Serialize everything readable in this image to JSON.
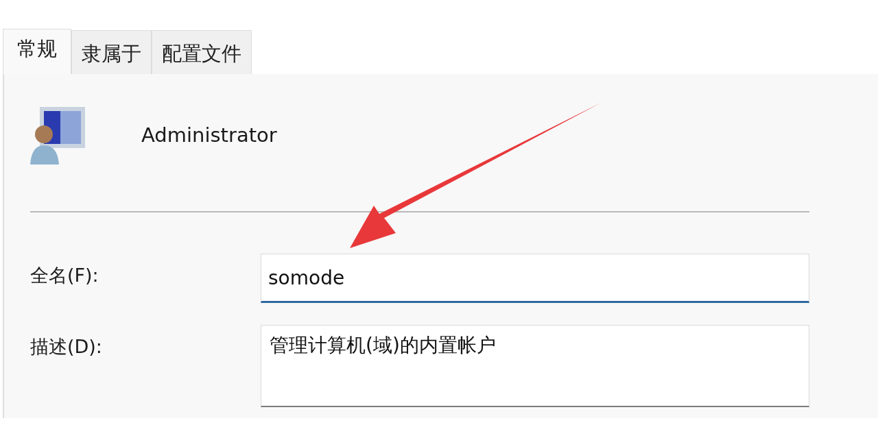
{
  "tabs": [
    {
      "label": "常规",
      "selected": true
    },
    {
      "label": "隶属于",
      "selected": false
    },
    {
      "label": "配置文件",
      "selected": false
    }
  ],
  "user": {
    "name": "Administrator"
  },
  "fields": [
    {
      "kind": "line",
      "label": "全名(F):",
      "value": "somode",
      "focused": true
    },
    {
      "kind": "multiline",
      "label": "描述(D):",
      "value": "管理计算机(域)的内置帐户",
      "focused": false
    }
  ],
  "annotation": {
    "kind": "arrow"
  }
}
